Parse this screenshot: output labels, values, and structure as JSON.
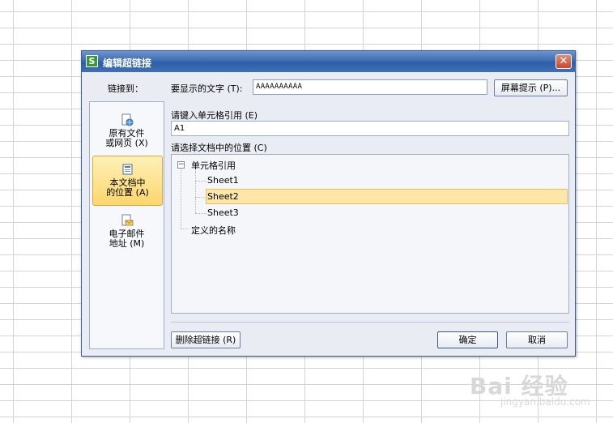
{
  "dialog": {
    "title": "编辑超链接",
    "app_icon": "S",
    "close_label": "✕",
    "link_to_label": "链接到：",
    "text_to_display_label": "要显示的文字 (T):",
    "text_to_display_value": "AAAAAAAAAA",
    "screentip_button": "屏幕提示 (P)...",
    "sidebar": {
      "items": [
        {
          "icon": "file-web-icon",
          "line1": "原有文件",
          "line2": "或网页 (X)"
        },
        {
          "icon": "document-location-icon",
          "line1": "本文档中",
          "line2": "的位置 (A)"
        },
        {
          "icon": "email-icon",
          "line1": "电子邮件",
          "line2": "地址 (M)"
        }
      ]
    },
    "cell_ref_label": "请键入单元格引用 (E)",
    "cell_ref_value": "A1",
    "place_label": "请选择文档中的位置 (C)",
    "tree": {
      "root": "单元格引用",
      "expander": "−",
      "children": [
        "Sheet1",
        "Sheet2",
        "Sheet3"
      ],
      "selected": "Sheet2",
      "defined_names": "定义的名称"
    },
    "remove_link_button": "删除超链接 (R)",
    "ok_button": "确定",
    "cancel_button": "取消"
  },
  "watermark": {
    "main": "Bai 经验",
    "sub": "jingyan.baidu.com"
  }
}
